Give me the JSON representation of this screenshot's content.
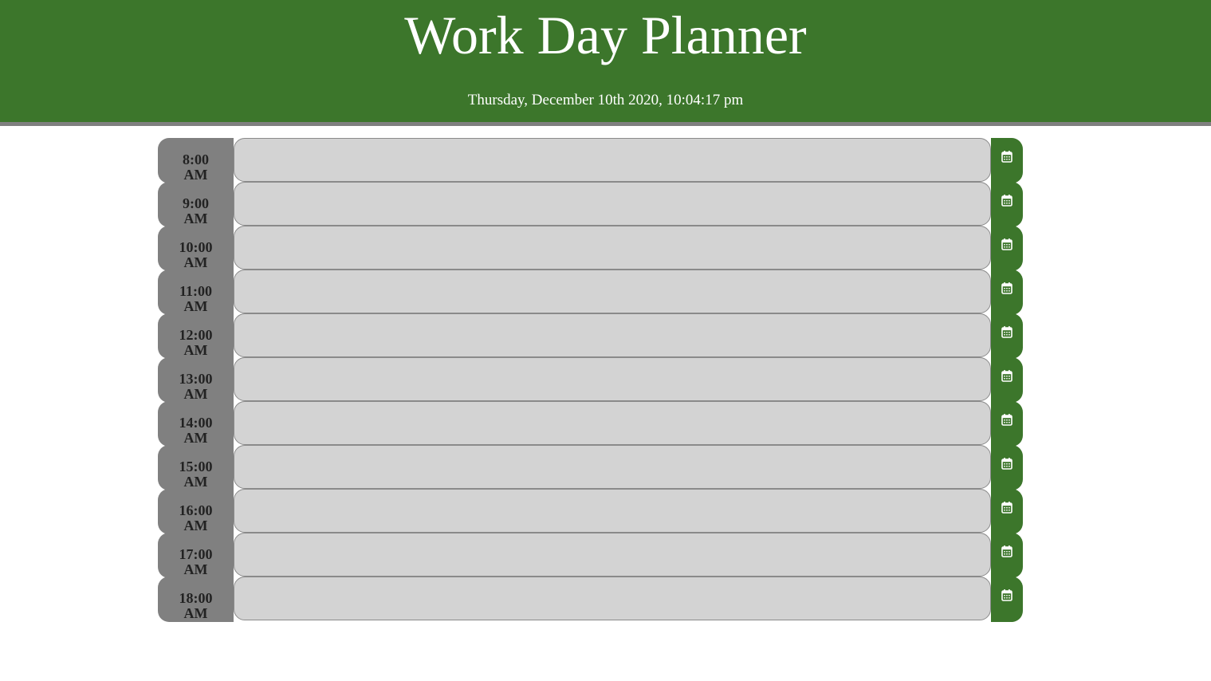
{
  "header": {
    "title": "Work Day Planner",
    "datetime": "Thursday, December 10th 2020, 10:04:17 pm"
  },
  "colors": {
    "header_bg": "#3c762b",
    "hour_bg": "#808080",
    "task_bg": "#d3d3d3",
    "save_bg": "#3c762b"
  },
  "save_icon": "calendar-icon",
  "rows": [
    {
      "time": "8:00",
      "period": "AM",
      "task": ""
    },
    {
      "time": "9:00",
      "period": "AM",
      "task": ""
    },
    {
      "time": "10:00",
      "period": "AM",
      "task": ""
    },
    {
      "time": "11:00",
      "period": "AM",
      "task": ""
    },
    {
      "time": "12:00",
      "period": "AM",
      "task": ""
    },
    {
      "time": "13:00",
      "period": "AM",
      "task": ""
    },
    {
      "time": "14:00",
      "period": "AM",
      "task": ""
    },
    {
      "time": "15:00",
      "period": "AM",
      "task": ""
    },
    {
      "time": "16:00",
      "period": "AM",
      "task": ""
    },
    {
      "time": "17:00",
      "period": "AM",
      "task": ""
    },
    {
      "time": "18:00",
      "period": "AM",
      "task": ""
    }
  ]
}
